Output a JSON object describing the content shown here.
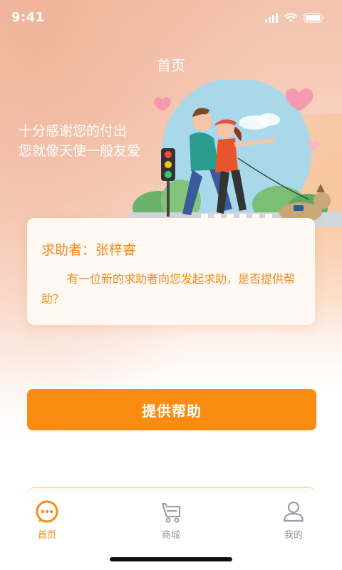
{
  "status_bar": {
    "time": "9:41"
  },
  "header": {
    "title": "首页"
  },
  "slogan": {
    "line1": "十分感谢您的付出",
    "line2": "您就像天使一般友爱"
  },
  "card": {
    "requester": "求助者：张梓睿",
    "message": "有一位新的求助者向您发起求助，是否提供帮助？"
  },
  "action": {
    "help_label": "提供帮助"
  },
  "tabs": [
    {
      "label": "首页",
      "icon": "chat-bubble-icon",
      "active": true
    },
    {
      "label": "商城",
      "icon": "cart-icon",
      "active": false
    },
    {
      "label": "我的",
      "icon": "user-icon",
      "active": false
    }
  ],
  "colors": {
    "accent": "#fb8c12",
    "text_orange": "#f08a1c",
    "tab_inactive": "#999999"
  }
}
